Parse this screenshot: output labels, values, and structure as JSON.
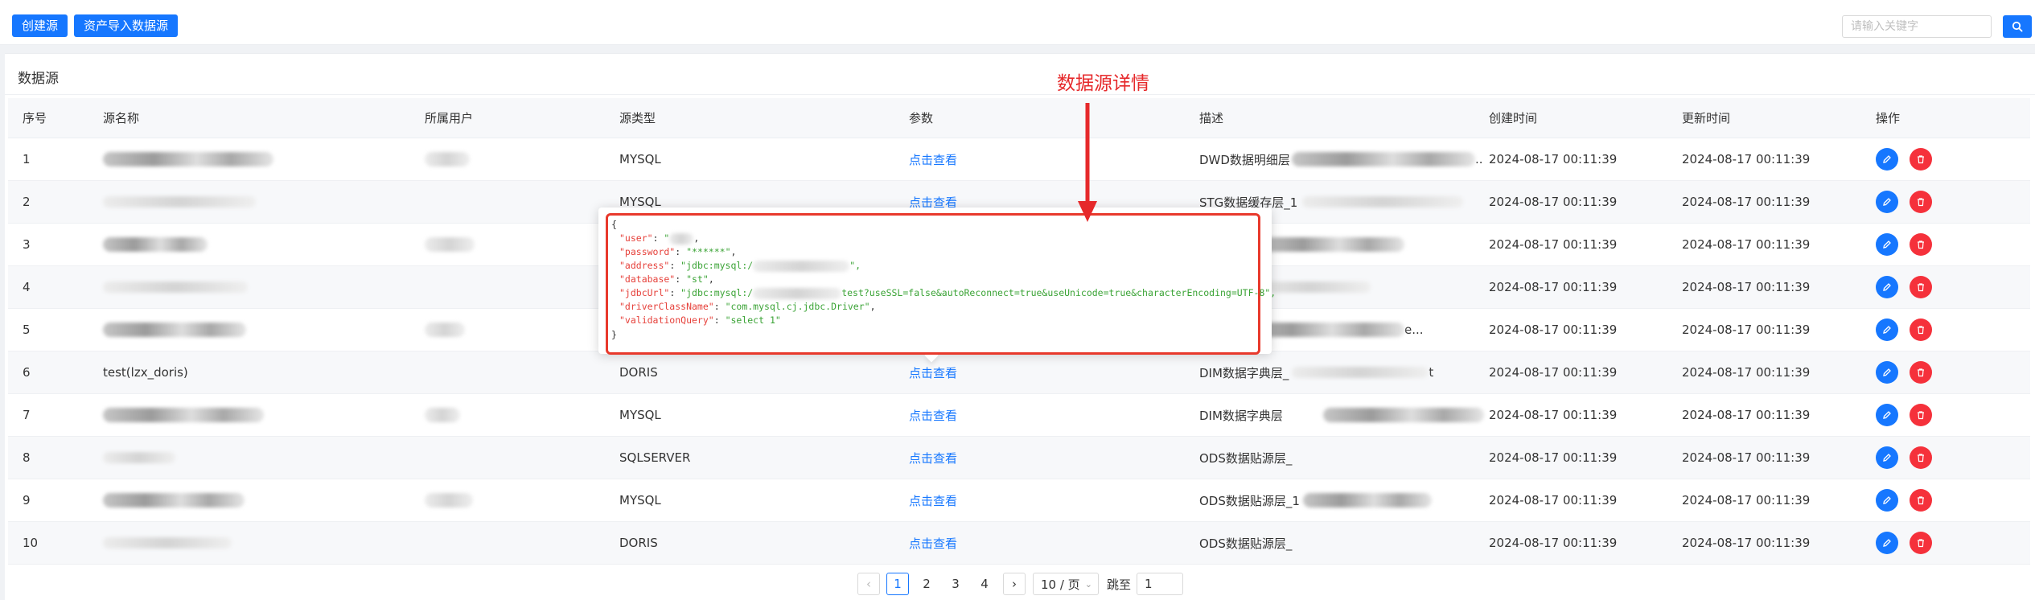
{
  "toolbar": {
    "create_label": "创建源",
    "import_label": "资产导入数据源",
    "search_placeholder": "请输入关键字"
  },
  "panel": {
    "title": "数据源"
  },
  "table": {
    "columns": [
      "序号",
      "源名称",
      "所属用户",
      "源类型",
      "参数",
      "描述",
      "创建时间",
      "更新时间",
      "操作"
    ],
    "rows": [
      {
        "seq": "1",
        "name": "",
        "type": "MYSQL",
        "param": "点击查看",
        "desc": "DWD数据明细层",
        "desc_suffix": "..",
        "created": "2024-08-17 00:11:39",
        "updated": "2024-08-17 00:11:39"
      },
      {
        "seq": "2",
        "name": "",
        "type": "MYSQL",
        "param": "点击查看",
        "desc": "STG数据缓存层_1",
        "desc_suffix": "",
        "created": "2024-08-17 00:11:39",
        "updated": "2024-08-17 00:11:39"
      },
      {
        "seq": "3",
        "name": "",
        "type": "",
        "param": "",
        "desc": "层",
        "desc_suffix": "",
        "created": "2024-08-17 00:11:39",
        "updated": "2024-08-17 00:11:39"
      },
      {
        "seq": "4",
        "name": "",
        "type": "",
        "param": "",
        "desc": "层_",
        "desc_suffix": "",
        "created": "2024-08-17 00:11:39",
        "updated": "2024-08-17 00:11:39"
      },
      {
        "seq": "5",
        "name": "",
        "type": "",
        "param": "",
        "desc": "层",
        "desc_suffix": "e...",
        "created": "2024-08-17 00:11:39",
        "updated": "2024-08-17 00:11:39"
      },
      {
        "seq": "6",
        "name": "test(lzx_doris)",
        "type": "DORIS",
        "param": "点击查看",
        "desc": "DIM数据字典层_",
        "desc_suffix": "t",
        "created": "2024-08-17 00:11:39",
        "updated": "2024-08-17 00:11:39"
      },
      {
        "seq": "7",
        "name": "",
        "type": "MYSQL",
        "param": "点击查看",
        "desc": "DIM数据字典层",
        "desc_suffix": "",
        "created": "2024-08-17 00:11:39",
        "updated": "2024-08-17 00:11:39"
      },
      {
        "seq": "8",
        "name": "",
        "type": "SQLSERVER",
        "param": "点击查看",
        "desc": "ODS数据贴源层_",
        "desc_suffix": "",
        "created": "2024-08-17 00:11:39",
        "updated": "2024-08-17 00:11:39"
      },
      {
        "seq": "9",
        "name": "",
        "type": "MYSQL",
        "param": "点击查看",
        "desc": "ODS数据贴源层_1",
        "desc_suffix": "",
        "created": "2024-08-17 00:11:39",
        "updated": "2024-08-17 00:11:39"
      },
      {
        "seq": "10",
        "name": "",
        "type": "DORIS",
        "param": "点击查看",
        "desc": "ODS数据贴源层_",
        "desc_suffix": "",
        "created": "2024-08-17 00:11:39",
        "updated": "2024-08-17 00:11:39"
      }
    ]
  },
  "popover": {
    "open": "{",
    "close": "}",
    "lines": [
      {
        "key": "\"user\"",
        "sep": ": ",
        "value": "\"",
        "tail": ","
      },
      {
        "key": "\"password\"",
        "sep": ": ",
        "value": "\"******\"",
        "tail": ","
      },
      {
        "key": "\"address\"",
        "sep": ": ",
        "value": "\"jdbc:mysql:/",
        "tail": "\","
      },
      {
        "key": "\"database\"",
        "sep": ": ",
        "value": "\"st\"",
        "tail": ","
      },
      {
        "key": "\"jdbcUrl\"",
        "sep": ": ",
        "value": "\"jdbc:mysql:/",
        "tail": "test?useSSL=false&autoReconnect=true&useUnicode=true&characterEncoding=UTF-8\","
      },
      {
        "key": "\"driverClassName\"",
        "sep": ": ",
        "value": "\"com.mysql.cj.jdbc.Driver\"",
        "tail": ","
      },
      {
        "key": "\"validationQuery\"",
        "sep": ": ",
        "value": "\"select 1\"",
        "tail": ""
      }
    ]
  },
  "annotation": {
    "label": "数据源详情",
    "color": "#e6292b"
  },
  "pagination": {
    "pages": [
      "1",
      "2",
      "3",
      "4"
    ],
    "current": "1",
    "page_size": "10 / 页",
    "jump_label": "跳至",
    "jump_value": "1"
  },
  "colors": {
    "primary": "#1677ff",
    "danger": "#f5313b",
    "highlight": "#e8392c"
  }
}
